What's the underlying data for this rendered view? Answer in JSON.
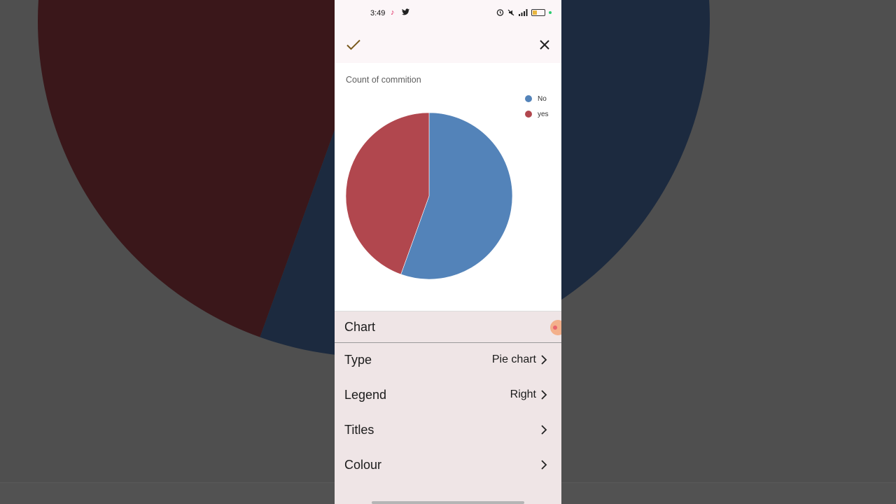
{
  "status_bar": {
    "time": "3:49",
    "app_icons": [
      "tiktok-icon",
      "twitter-icon"
    ],
    "right_icons": [
      "alarm-icon",
      "mute-icon",
      "signal-icon",
      "battery-icon"
    ]
  },
  "top_bar": {
    "confirm_icon": "check-icon",
    "close_icon": "close-icon"
  },
  "chart_data": {
    "type": "pie",
    "title": "Count of commition",
    "categories": [
      "No",
      "yes"
    ],
    "values": [
      55.5,
      44.5
    ],
    "colors": [
      "#5383b9",
      "#b1474e"
    ],
    "legend_position": "right"
  },
  "panel": {
    "header": "Chart",
    "rows": [
      {
        "label": "Type",
        "value": "Pie chart"
      },
      {
        "label": "Legend",
        "value": "Right"
      },
      {
        "label": "Titles",
        "value": ""
      },
      {
        "label": "Colour",
        "value": ""
      }
    ]
  },
  "colors": {
    "background": "#4f4f4f",
    "panel_bg": "#efe5e6",
    "top_bar_bg": "#fcf6f8",
    "bg_blue": "#1c2a3f",
    "bg_red": "#3a171a"
  }
}
